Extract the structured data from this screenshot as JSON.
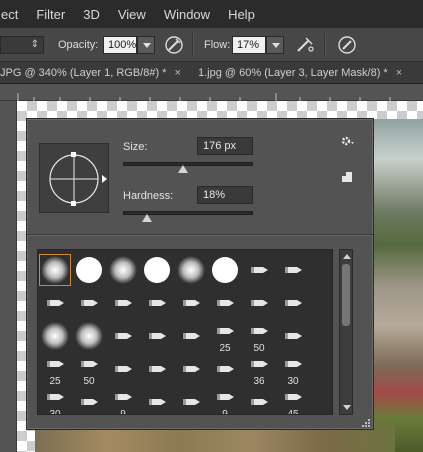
{
  "menu": {
    "items": [
      "ect",
      "Filter",
      "3D",
      "View",
      "Window",
      "Help"
    ]
  },
  "options": {
    "opacity_label": "Opacity:",
    "opacity_value": "100%",
    "flow_label": "Flow:",
    "flow_value": "17%",
    "airbrush_icon": "airbrush-icon",
    "pressure_opacity_icon": "pressure-opacity-icon",
    "pressure_size_icon": "pressure-size-icon"
  },
  "tabs": [
    {
      "label": "JPG @ 340% (Layer 1, RGB/8#) *",
      "close": "×"
    },
    {
      "label": "1.jpg @ 60% (Layer 3, Layer Mask/8) *",
      "close": "×"
    }
  ],
  "brush_panel": {
    "size_label": "Size:",
    "size_value": "176 px",
    "size_level": 0.45,
    "hardness_label": "Hardness:",
    "hardness_value": "18%",
    "hardness_level": 0.18,
    "settings_icon": "gear-icon",
    "new_preset_icon": "new-preset-icon"
  },
  "brushes": [
    {
      "kind": "soft",
      "num": ""
    },
    {
      "kind": "hard",
      "num": ""
    },
    {
      "kind": "soft",
      "num": ""
    },
    {
      "kind": "hard",
      "num": ""
    },
    {
      "kind": "soft",
      "num": ""
    },
    {
      "kind": "hard",
      "num": ""
    },
    {
      "kind": "tip",
      "num": ""
    },
    {
      "kind": "tip",
      "num": ""
    },
    {
      "kind": "tip",
      "num": ""
    },
    {
      "kind": "tip",
      "num": ""
    },
    {
      "kind": "tip",
      "num": ""
    },
    {
      "kind": "tip",
      "num": ""
    },
    {
      "kind": "tip",
      "num": ""
    },
    {
      "kind": "tip",
      "num": ""
    },
    {
      "kind": "tip",
      "num": ""
    },
    {
      "kind": "tip",
      "num": ""
    },
    {
      "kind": "soft",
      "num": ""
    },
    {
      "kind": "soft",
      "num": ""
    },
    {
      "kind": "tip",
      "num": ""
    },
    {
      "kind": "tip",
      "num": ""
    },
    {
      "kind": "tip",
      "num": ""
    },
    {
      "kind": "tip",
      "num": "25"
    },
    {
      "kind": "tip",
      "num": "50"
    },
    {
      "kind": "tip",
      "num": ""
    },
    {
      "kind": "tip",
      "num": "25"
    },
    {
      "kind": "tip",
      "num": "50"
    },
    {
      "kind": "tip",
      "num": ""
    },
    {
      "kind": "tip",
      "num": ""
    },
    {
      "kind": "tip",
      "num": ""
    },
    {
      "kind": "tip",
      "num": ""
    },
    {
      "kind": "tip",
      "num": "36"
    },
    {
      "kind": "tip",
      "num": "30"
    },
    {
      "kind": "tip",
      "num": "30"
    },
    {
      "kind": "tip",
      "num": ""
    },
    {
      "kind": "tip",
      "num": "9"
    },
    {
      "kind": "tip",
      "num": ""
    },
    {
      "kind": "tip",
      "num": ""
    },
    {
      "kind": "tip",
      "num": "9"
    },
    {
      "kind": "tip",
      "num": ""
    },
    {
      "kind": "tip",
      "num": "45"
    }
  ]
}
